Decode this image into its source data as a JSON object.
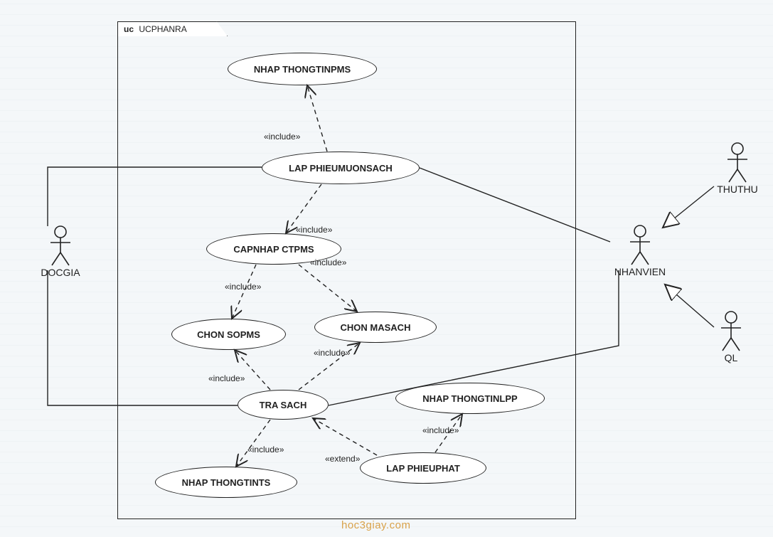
{
  "diagram": {
    "frame_prefix": "uc",
    "frame_name": "UCPHANRA",
    "watermark": "hoc3giay.com"
  },
  "actors": {
    "docgia": "DOCGIA",
    "nhanvien": "NHANVIEN",
    "thuthu": "THUTHU",
    "ql": "QL"
  },
  "usecases": {
    "nhap_thongtinpms": "NHAP THONGTINPMS",
    "lap_phieumuonsach": "LAP PHIEUMUONSACH",
    "capnhap_ctpms": "CAPNHAP CTPMS",
    "chon_sopms": "CHON SOPMS",
    "chon_masach": "CHON MASACH",
    "tra_sach": "TRA SACH",
    "nhap_thongtinlpp": "NHAP THONGTINLPP",
    "nhap_thongtints": "NHAP THONGTINTS",
    "lap_phieuphat": "LAP PHIEUPHAT"
  },
  "stereotypes": {
    "include": "«include»",
    "extend": "«extend»"
  },
  "chart_data": {
    "type": "uml-use-case",
    "boundary": "UCPHANRA",
    "actors": [
      "DOCGIA",
      "NHANVIEN",
      "THUTHU",
      "QL"
    ],
    "use_cases": [
      "NHAP THONGTINPMS",
      "LAP PHIEUMUONSACH",
      "CAPNHAP CTPMS",
      "CHON SOPMS",
      "CHON MASACH",
      "TRA SACH",
      "NHAP THONGTINLPP",
      "NHAP THONGTINTS",
      "LAP PHIEUPHAT"
    ],
    "associations": [
      {
        "actor": "DOCGIA",
        "usecase": "LAP PHIEUMUONSACH"
      },
      {
        "actor": "DOCGIA",
        "usecase": "TRA SACH"
      },
      {
        "actor": "NHANVIEN",
        "usecase": "LAP PHIEUMUONSACH"
      },
      {
        "actor": "NHANVIEN",
        "usecase": "TRA SACH"
      }
    ],
    "generalizations": [
      {
        "child": "THUTHU",
        "parent": "NHANVIEN"
      },
      {
        "child": "QL",
        "parent": "NHANVIEN"
      }
    ],
    "includes": [
      {
        "from": "LAP PHIEUMUONSACH",
        "to": "NHAP THONGTINPMS"
      },
      {
        "from": "LAP PHIEUMUONSACH",
        "to": "CAPNHAP CTPMS"
      },
      {
        "from": "CAPNHAP CTPMS",
        "to": "CHON SOPMS"
      },
      {
        "from": "CAPNHAP CTPMS",
        "to": "CHON MASACH"
      },
      {
        "from": "TRA SACH",
        "to": "CHON SOPMS"
      },
      {
        "from": "TRA SACH",
        "to": "CHON MASACH"
      },
      {
        "from": "TRA SACH",
        "to": "NHAP THONGTINTS"
      },
      {
        "from": "LAP PHIEUPHAT",
        "to": "NHAP THONGTINLPP"
      }
    ],
    "extends": [
      {
        "from": "LAP PHIEUPHAT",
        "to": "TRA SACH"
      }
    ]
  }
}
